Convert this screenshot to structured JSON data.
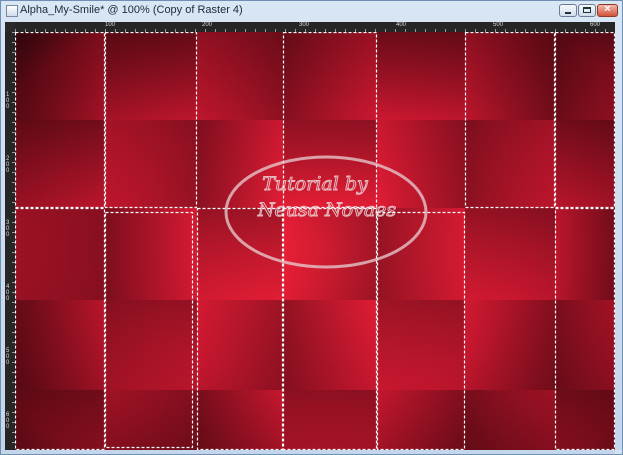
{
  "window": {
    "title": "Alpha_My-Smile* @ 100% (Copy of Raster 4)",
    "buttons": {
      "minimize": "minimize",
      "maximize": "maximize",
      "close": "×"
    }
  },
  "ruler": {
    "horizontal_labels": [
      "100",
      "200",
      "300",
      "400",
      "500",
      "600",
      "700",
      "800"
    ],
    "vertical_labels": [
      "100",
      "200",
      "300",
      "400",
      "500",
      "600"
    ]
  },
  "watermark": {
    "line1": "Tutorial by",
    "line2": "Neusa Novaes"
  },
  "colors": {
    "dark_red": "#5e0914",
    "mid_red": "#b4152e",
    "bright_red": "#ec1e38",
    "selection": "#ffffff"
  }
}
